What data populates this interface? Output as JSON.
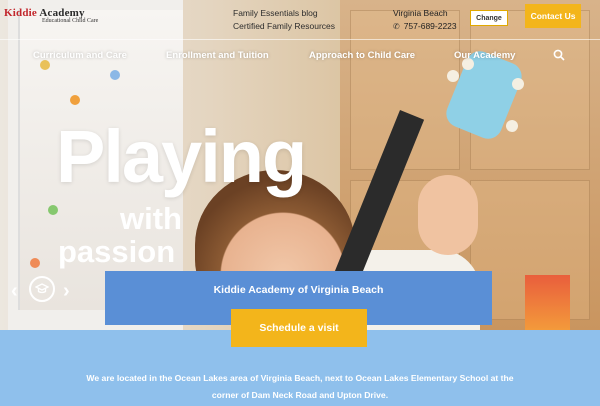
{
  "header": {
    "logo": {
      "main_left": "Kiddie",
      "main_right": "Academy",
      "tagline": "Educational Child Care"
    },
    "top_links": [
      "Family Essentials blog",
      "Certified Family Resources"
    ],
    "location": {
      "city": "Virginia Beach",
      "phone": "757-689-2223"
    },
    "change_label": "Change",
    "contact_label": "Contact Us"
  },
  "nav": {
    "items": [
      "Curriculum and Care",
      "Enrollment and Tuition",
      "Approach to Child Care",
      "Our Academy"
    ]
  },
  "hero": {
    "headline_1": "Playing",
    "headline_2": "with",
    "headline_3": "passion",
    "prev_arrow": "‹",
    "next_arrow": "›"
  },
  "banner": {
    "title": "Kiddie Academy of Virginia Beach",
    "cta_label": "Schedule a visit"
  },
  "info": {
    "text_line_1": "We are located in the Ocean Lakes area of Virginia Beach, next to Ocean Lakes Elementary School at the",
    "text_line_2": "corner of Dam Neck Road and Upton Drive."
  },
  "colors": {
    "accent_yellow": "#f3b51b",
    "banner_blue": "#5a8fd6",
    "section_blue": "#8fc0ec",
    "logo_red": "#c2272d"
  }
}
